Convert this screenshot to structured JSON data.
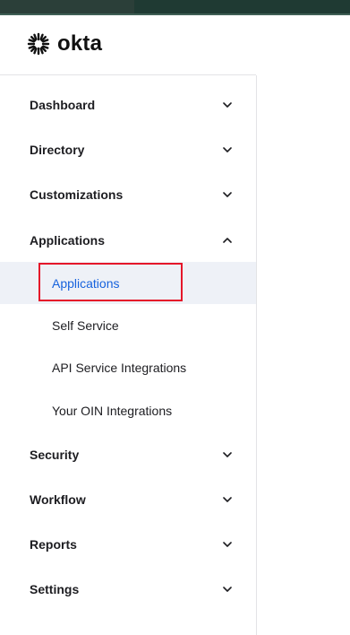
{
  "brand": {
    "name": "okta",
    "logo_icon": "okta-sunburst-icon"
  },
  "sidebar": {
    "items": [
      {
        "label": "Dashboard",
        "icon": "chevron-down-icon"
      },
      {
        "label": "Directory",
        "icon": "chevron-down-icon"
      },
      {
        "label": "Customizations",
        "icon": "chevron-down-icon"
      },
      {
        "label": "Applications",
        "icon": "chevron-up-icon",
        "expanded": true,
        "children": [
          {
            "label": "Applications",
            "active": true
          },
          {
            "label": "Self Service"
          },
          {
            "label": "API Service Integrations"
          },
          {
            "label": "Your OIN Integrations"
          }
        ]
      },
      {
        "label": "Security",
        "icon": "chevron-down-icon"
      },
      {
        "label": "Workflow",
        "icon": "chevron-down-icon"
      },
      {
        "label": "Reports",
        "icon": "chevron-down-icon"
      },
      {
        "label": "Settings",
        "icon": "chevron-down-icon"
      }
    ]
  },
  "colors": {
    "topbar": "#1f3a33",
    "active_text": "#1662dd",
    "active_bg": "#eef1f7",
    "highlight_border": "#e5162a"
  }
}
